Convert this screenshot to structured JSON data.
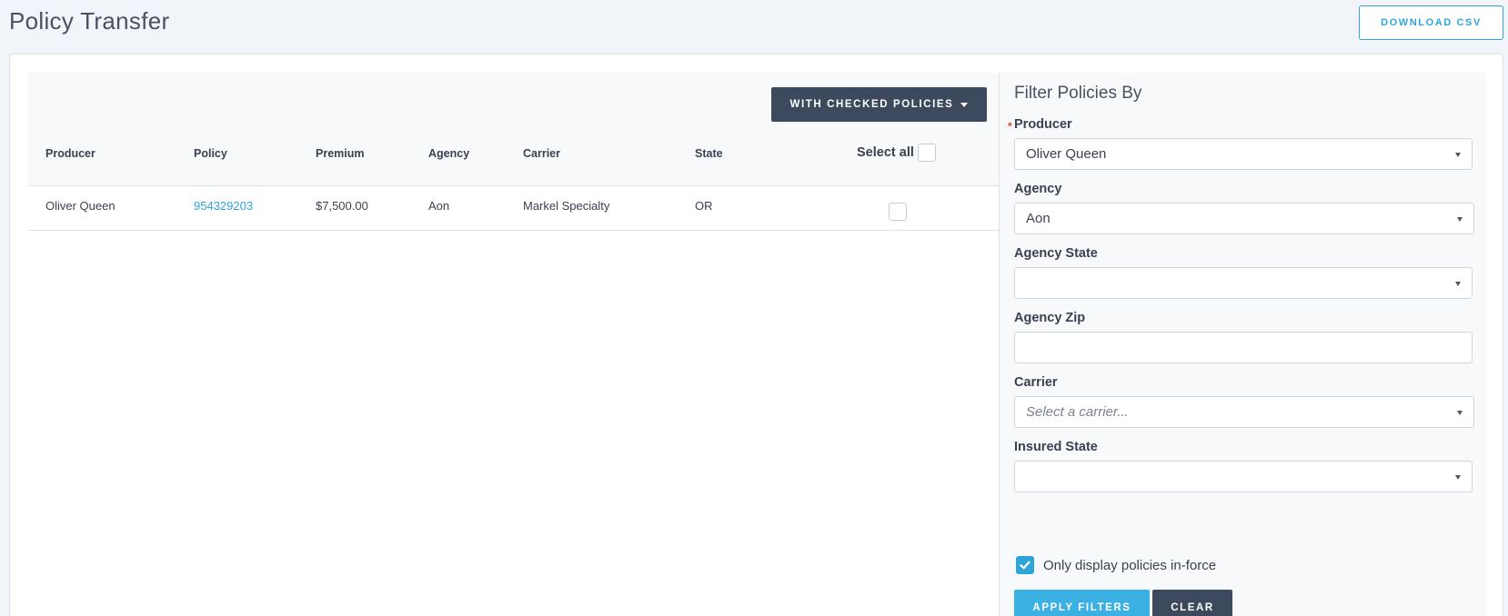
{
  "page": {
    "title": "Policy Transfer",
    "download_label": "DOWNLOAD CSV"
  },
  "table": {
    "bulk_action_label": "WITH CHECKED POLICIES",
    "columns": {
      "producer": "Producer",
      "policy": "Policy",
      "premium": "Premium",
      "agency": "Agency",
      "carrier": "Carrier",
      "state": "State",
      "select_all": "Select all"
    },
    "rows": [
      {
        "producer": "Oliver Queen",
        "policy": "954329203",
        "premium": "$7,500.00",
        "agency": "Aon",
        "carrier": "Markel Specialty",
        "state": "OR",
        "checked": false
      }
    ]
  },
  "filters": {
    "title": "Filter Policies By",
    "producer": {
      "label": "Producer",
      "value": "Oliver Queen",
      "required": true
    },
    "agency": {
      "label": "Agency",
      "value": "Aon"
    },
    "agency_state": {
      "label": "Agency State",
      "value": ""
    },
    "agency_zip": {
      "label": "Agency Zip",
      "value": ""
    },
    "carrier": {
      "label": "Carrier",
      "value": "",
      "placeholder": "Select a carrier..."
    },
    "insured_state": {
      "label": "Insured State",
      "value": ""
    },
    "inforce": {
      "label": "Only display policies in-force",
      "checked": true
    },
    "apply_label": "APPLY FILTERS",
    "clear_label": "CLEAR"
  },
  "colors": {
    "accent": "#2fa4d9",
    "dark_button": "#3d4a5e",
    "required": "#e04a2f"
  }
}
